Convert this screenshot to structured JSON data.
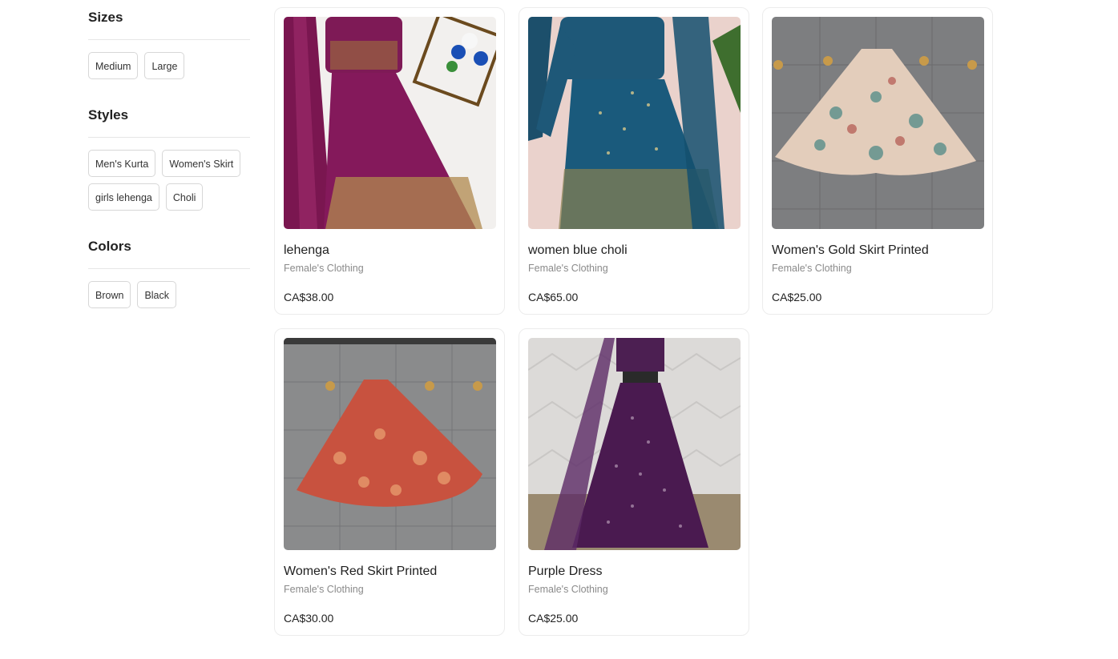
{
  "filters": {
    "sizes": {
      "title": "Sizes",
      "options": [
        "Medium",
        "Large"
      ]
    },
    "styles": {
      "title": "Styles",
      "options": [
        "Men's Kurta",
        "Women's Skirt",
        "girls lehenga",
        "Choli"
      ]
    },
    "colors": {
      "title": "Colors",
      "options": [
        "Brown",
        "Black"
      ]
    }
  },
  "products": [
    {
      "name": "lehenga",
      "category": "Female's Clothing",
      "price": "CA$38.00"
    },
    {
      "name": "women blue choli",
      "category": "Female's Clothing",
      "price": "CA$65.00"
    },
    {
      "name": "Women's Gold Skirt Printed",
      "category": "Female's Clothing",
      "price": "CA$25.00"
    },
    {
      "name": "Women's Red Skirt Printed",
      "category": "Female's Clothing",
      "price": "CA$30.00"
    },
    {
      "name": "Purple Dress",
      "category": "Female's Clothing",
      "price": "CA$25.00"
    }
  ]
}
